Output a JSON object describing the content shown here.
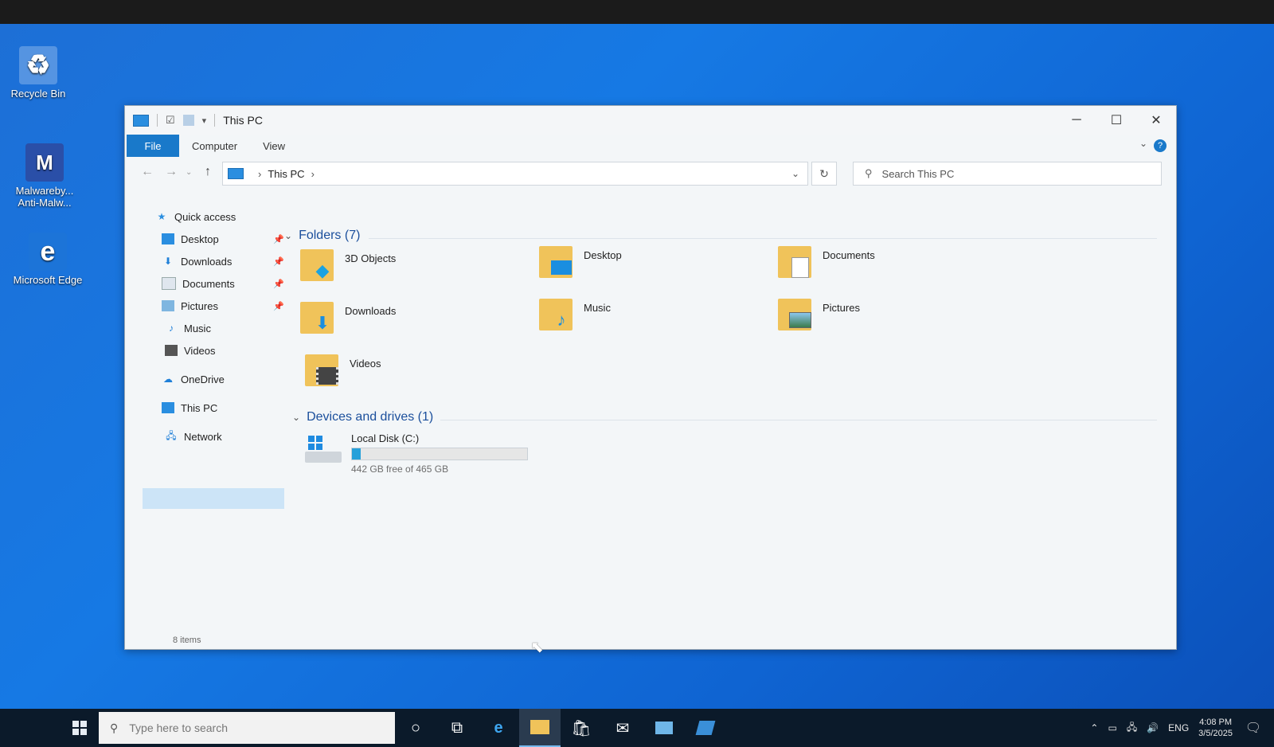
{
  "desktop": {
    "icons": [
      {
        "label": "Recycle Bin",
        "icon": "recycle-bin-icon"
      },
      {
        "label": "Malwareby... Anti-Malw...",
        "icon": "malwarebytes-icon"
      },
      {
        "label": "Microsoft Edge",
        "icon": "edge-icon"
      }
    ]
  },
  "window": {
    "title": "This PC",
    "ribbon_tabs": [
      "File",
      "Computer",
      "View"
    ],
    "address": {
      "segments": [
        "This PC"
      ]
    },
    "search_placeholder": "Search This PC",
    "status_text": "8 items"
  },
  "navigation": {
    "quick_access": "Quick access",
    "items": [
      {
        "label": "Desktop",
        "pinned": true,
        "icon": "desktop-icon"
      },
      {
        "label": "Downloads",
        "pinned": true,
        "icon": "downloads-icon"
      },
      {
        "label": "Documents",
        "pinned": true,
        "icon": "documents-icon"
      },
      {
        "label": "Pictures",
        "pinned": true,
        "icon": "pictures-icon"
      },
      {
        "label": "Music",
        "pinned": false,
        "icon": "music-icon"
      },
      {
        "label": "Videos",
        "pinned": false,
        "icon": "videos-icon"
      }
    ],
    "onedrive": "OneDrive",
    "this_pc": "This PC",
    "network": "Network"
  },
  "content": {
    "folders_header": "Folders (7)",
    "folders": [
      {
        "name": "3D Objects",
        "icon": "3d-objects-icon"
      },
      {
        "name": "Desktop",
        "icon": "desktop-icon"
      },
      {
        "name": "Documents",
        "icon": "documents-icon"
      },
      {
        "name": "Downloads",
        "icon": "downloads-icon"
      },
      {
        "name": "Music",
        "icon": "music-icon"
      },
      {
        "name": "Pictures",
        "icon": "pictures-icon"
      },
      {
        "name": "Videos",
        "icon": "videos-icon"
      }
    ],
    "devices_header": "Devices and drives (1)",
    "drive": {
      "name": "Local Disk (C:)",
      "free_text": "442 GB free of 465 GB",
      "used_fraction": 0.05
    }
  },
  "taskbar": {
    "search_placeholder": "Type here to search",
    "apps": [
      "cortana-icon",
      "task-view-icon",
      "edge-icon",
      "file-explorer-icon",
      "store-icon",
      "mail-icon",
      "photos-icon",
      "app-icon"
    ],
    "language": "ENG",
    "time": "4:08 PM",
    "date": "3/5/2025"
  },
  "colors": {
    "accent": "#1979ca",
    "desktop": "#1679e4",
    "folder": "#f0c35a",
    "drive_fill": "#26a0da"
  }
}
